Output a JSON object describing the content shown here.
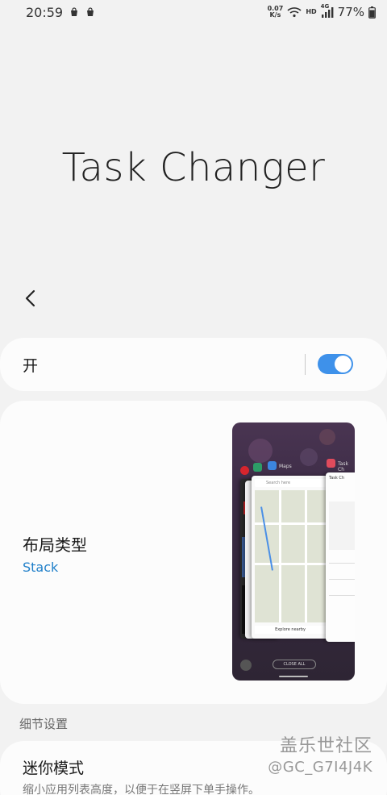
{
  "status_bar": {
    "time": "20:59",
    "net_speed_value": "0.07",
    "net_speed_unit": "K/s",
    "hd_label": "HD",
    "network_label": "4G",
    "battery": "77%"
  },
  "header": {
    "title": "Task Changer"
  },
  "master_toggle": {
    "label": "开",
    "state": "on",
    "accent": "#3e91ea"
  },
  "layout_type": {
    "title": "布局类型",
    "value": "Stack",
    "value_color": "#1f7fc9",
    "preview": {
      "app_labels": [
        "Maps",
        "Task Ch"
      ],
      "card_headers": [
        "Search here",
        "Task Ch"
      ],
      "bottom_button": "CLOSE ALL",
      "map_caption": "Explore nearby"
    }
  },
  "section": {
    "details_header": "细节设置"
  },
  "mini_mode": {
    "title": "迷你模式",
    "description": "缩小应用列表高度，以便于在竖屏下单手操作。"
  },
  "watermark": {
    "line1": "盖乐世社区",
    "line2": "@GC_G7I4J4K"
  }
}
